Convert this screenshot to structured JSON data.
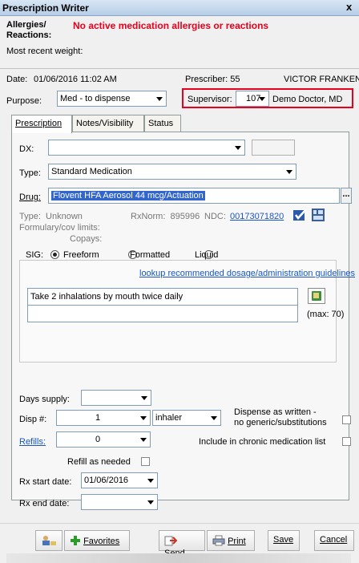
{
  "window": {
    "title": "Prescription Writer",
    "close_glyph": "x"
  },
  "header": {
    "allergies_label": "Allergies/",
    "reactions_label": "Reactions:",
    "allergies_value": "No active medication allergies or reactions",
    "weight_label": "Most recent weight:"
  },
  "info": {
    "date_label": "Date:",
    "date_value": "01/06/2016 11:02 AM",
    "prescriber_label": "Prescriber: 55",
    "prescriber_name": "VICTOR FRANKEN",
    "purpose_label": "Purpose:",
    "purpose_value": "Med - to dispense",
    "supervisor_label": "Supervisor:",
    "supervisor_id": "107",
    "supervisor_name": "Demo Doctor, MD"
  },
  "tabs": {
    "prescription": "Prescription",
    "notes": "Notes/Visibility",
    "status": "Status"
  },
  "form": {
    "dx_label": "DX:",
    "dx_value": "",
    "type_label": "Type:",
    "type_value": "Standard Medication",
    "drug_label": "Drug:",
    "drug_value": "Flovent HFA Aerosol 44 mcg/Actuation",
    "drug_ellipsis": "...",
    "drug_type": "Type:  Unknown",
    "rxnorm": "RxNorm:  895996",
    "ndc_label": "NDC:",
    "ndc_value": "00173071820",
    "formulary": "Formulary/cov limits:",
    "copays": "Copays:",
    "sig_label": "SIG:",
    "sig_freeform": "Freeform",
    "sig_formatted": "Formatted",
    "sig_liquid": "Liquid",
    "lookup_link": "lookup recommended dosage/administration guidelines",
    "sig_text": "Take 2 inhalations by mouth twice daily",
    "sig_text2": "",
    "max_label": "(max: 70)",
    "days_supply_label": "Days supply:",
    "days_supply_value": "",
    "disp_label": "Disp #:",
    "disp_value": "1",
    "disp_unit": "inhaler",
    "daw_label_1": "Dispense as written -",
    "daw_label_2": "no generic/substitutions",
    "refills_label": "Refills:",
    "refills_value": "0",
    "chronic_label": "Include in chronic medication list",
    "refill_needed_label": "Refill as needed",
    "rx_start_label": "Rx start date:",
    "rx_start_value": "01/06/2016",
    "rx_end_label": "Rx end date:",
    "rx_end_value": ""
  },
  "buttons": {
    "favorites": "Favorites",
    "send": "Send",
    "print": "Print",
    "save": "Save",
    "cancel": "Cancel"
  },
  "colors": {
    "alert": "#e8001c",
    "link": "#1a56c4",
    "selection": "#3366cc"
  }
}
